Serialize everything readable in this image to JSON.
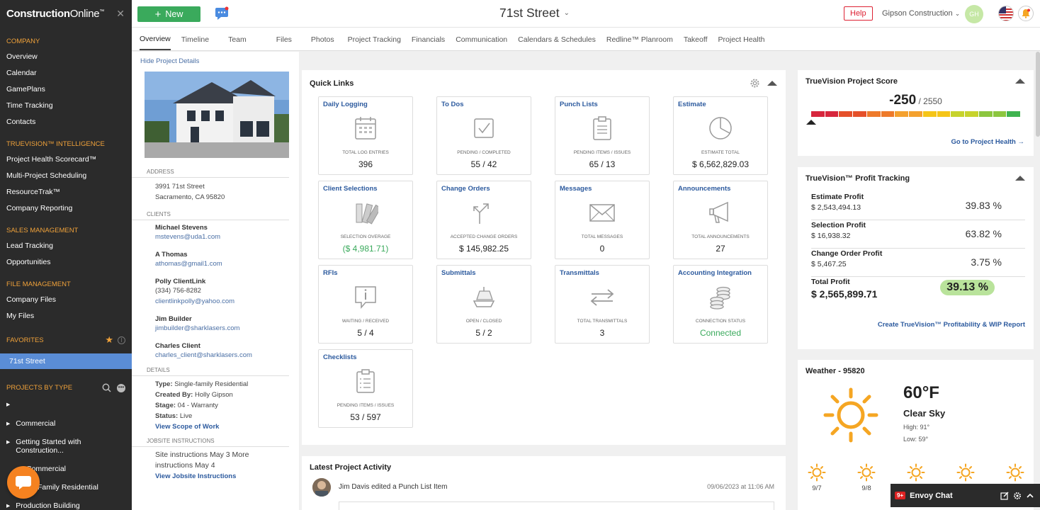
{
  "sidebar": {
    "logo_main": "Construction",
    "logo_sub": "Online",
    "logo_tm": "™",
    "close": "✕",
    "company": {
      "heading": "COMPANY",
      "items": [
        "Overview",
        "Calendar",
        "GamePlans",
        "Time Tracking",
        "Contacts"
      ]
    },
    "truevision": {
      "heading": "TRUEVISION™ INTELLIGENCE",
      "items": [
        "Project Health Scorecard™",
        "Multi-Project Scheduling",
        "ResourceTrak™",
        "Company Reporting"
      ]
    },
    "sales": {
      "heading": "SALES MANAGEMENT",
      "items": [
        "Lead Tracking",
        "Opportunities"
      ]
    },
    "files": {
      "heading": "FILE MANAGEMENT",
      "items": [
        "Company Files",
        "My Files"
      ]
    },
    "favorites": {
      "heading": "FAVORITES",
      "selected": "71st Street"
    },
    "projects_by_type": {
      "heading": "PROJECTS BY TYPE",
      "items": [
        "",
        "Commercial",
        "Getting Started with Construction...",
        "Commercial",
        "Family Residential",
        "Production Building"
      ]
    }
  },
  "topbar": {
    "new_label": "New",
    "project_title": "71st Street",
    "help": "Help",
    "user": "Gipson Construction",
    "avatar_initials": "GH"
  },
  "tabs": [
    "Overview",
    "Timeline",
    "Team",
    "Files",
    "Photos",
    "Project Tracking",
    "Financials",
    "Communication",
    "Calendars & Schedules",
    "Redline™ Planroom",
    "Takeoff",
    "Project Health"
  ],
  "details": {
    "hide_link": "Hide Project Details",
    "address_label": "ADDRESS",
    "address_line1": "3991 71st Street",
    "address_line2": "Sacramento, CA 95820",
    "clients_label": "CLIENTS",
    "clients": [
      {
        "name": "Michael Stevens",
        "phone": "",
        "email": "mstevens@uda1.com"
      },
      {
        "name": "A Thomas",
        "phone": "",
        "email": "athomas@gmail1.com"
      },
      {
        "name": "Polly ClientLink",
        "phone": "(334) 756-8282",
        "email": "clientlinkpolly@yahoo.com"
      },
      {
        "name": "Jim Builder",
        "phone": "",
        "email": "jimbuilder@sharklasers.com"
      },
      {
        "name": "Charles Client",
        "phone": "",
        "email": "charles_client@sharklasers.com"
      }
    ],
    "details_label": "DETAILS",
    "type_k": "Type:",
    "type_v": " Single-family Residential",
    "created_k": "Created By:",
    "created_v": " Holly Gipson",
    "stage_k": "Stage:",
    "stage_v": " 04 - Warranty",
    "status_k": "Status:",
    "status_v": " Live",
    "scope_link": "View Scope of Work",
    "jobsite_label": "JOBSITE INSTRUCTIONS",
    "jobsite_text1": "Site instructions May 3 More",
    "jobsite_text2": "instructions May 4",
    "jobsite_link": "View Jobsite Instructions"
  },
  "quick_links": {
    "title": "Quick Links",
    "cards": [
      {
        "title": "Daily Logging",
        "label": "TOTAL LOG ENTRIES",
        "value": "396",
        "icon": "calendar-icon"
      },
      {
        "title": "To Dos",
        "label": "PENDING / COMPLETED",
        "value": "55 / 42",
        "icon": "checkbox-icon"
      },
      {
        "title": "Punch Lists",
        "label": "PENDING ITEMS / ISSUES",
        "value": "65 / 13",
        "icon": "clipboard-icon"
      },
      {
        "title": "Estimate",
        "label": "ESTIMATE TOTAL",
        "value": "$ 6,562,829.03",
        "icon": "pie-icon"
      },
      {
        "title": "Client Selections",
        "label": "SELECTION OVERAGE",
        "value": "($ 4,981.71)",
        "icon": "swatch-icon"
      },
      {
        "title": "Change Orders",
        "label": "ACCEPTED CHANGE ORDERS",
        "value": "$ 145,982.25",
        "icon": "branch-icon"
      },
      {
        "title": "Messages",
        "label": "TOTAL MESSAGES",
        "value": "0",
        "icon": "envelope-icon"
      },
      {
        "title": "Announcements",
        "label": "TOTAL ANNOUNCEMENTS",
        "value": "27",
        "icon": "megaphone-icon"
      },
      {
        "title": "RFIs",
        "label": "WAITING / RECEIVED",
        "value": "5 / 4",
        "icon": "info-bubble-icon"
      },
      {
        "title": "Submittals",
        "label": "OPEN / CLOSED",
        "value": "5 / 2",
        "icon": "tray-icon"
      },
      {
        "title": "Transmittals",
        "label": "TOTAL TRANSMITTALS",
        "value": "3",
        "icon": "arrows-icon"
      },
      {
        "title": "Accounting Integration",
        "label": "CONNECTION STATUS",
        "value": "Connected",
        "icon": "coins-icon"
      },
      {
        "title": "Checklists",
        "label": "PENDING ITEMS / ISSUES",
        "value": "53 / 597",
        "icon": "checklist-icon"
      }
    ]
  },
  "activity": {
    "title": "Latest Project Activity",
    "text": "Jim Davis edited a Punch List Item",
    "date": "09/06/2023 at 11:06 AM"
  },
  "truevision": {
    "title": "TrueVision Project Score",
    "score": "-250",
    "out_of": " / 2550",
    "link": "Go to Project Health →",
    "score_value": -250,
    "score_max": 2550,
    "bar_colors": [
      "#d7263d",
      "#d7263d",
      "#e5502a",
      "#e5502a",
      "#ee7a2a",
      "#ee7a2a",
      "#f4a12e",
      "#f4a12e",
      "#f5c518",
      "#f5c518",
      "#c7d32c",
      "#c7d32c",
      "#8cc63f",
      "#8cc63f",
      "#3fb34f"
    ]
  },
  "profit": {
    "title": "TrueVision™ Profit Tracking",
    "rows": [
      {
        "name": "Estimate Profit",
        "amount": "$ 2,543,494.13",
        "pct": "39.83 %"
      },
      {
        "name": "Selection Profit",
        "amount": "$ 16,938.32",
        "pct": "63.82 %"
      },
      {
        "name": "Change Order Profit",
        "amount": "$ 5,467.25",
        "pct": "3.75 %"
      }
    ],
    "total_name": "Total Profit",
    "total_amount": "$ 2,565,899.71",
    "total_pct": "39.13 %",
    "link": "Create TrueVision™ Profitability & WIP Report"
  },
  "weather": {
    "title": "Weather - 95820",
    "temp": "60°F",
    "condition": "Clear Sky",
    "high": "High: 91°",
    "low": "Low: 59°",
    "forecast": [
      "9/7",
      "9/8",
      "",
      "",
      ""
    ]
  },
  "envoy": {
    "badge": "9+",
    "label": "Envoy Chat"
  },
  "colors": {
    "accent": "#2c5a9e",
    "new_button": "#3aaa5c",
    "sidebar": "#2b2b2b",
    "sidebar_heading": "#f0a23a",
    "selected": "#5a8dd6",
    "sun": "#f5a623"
  }
}
